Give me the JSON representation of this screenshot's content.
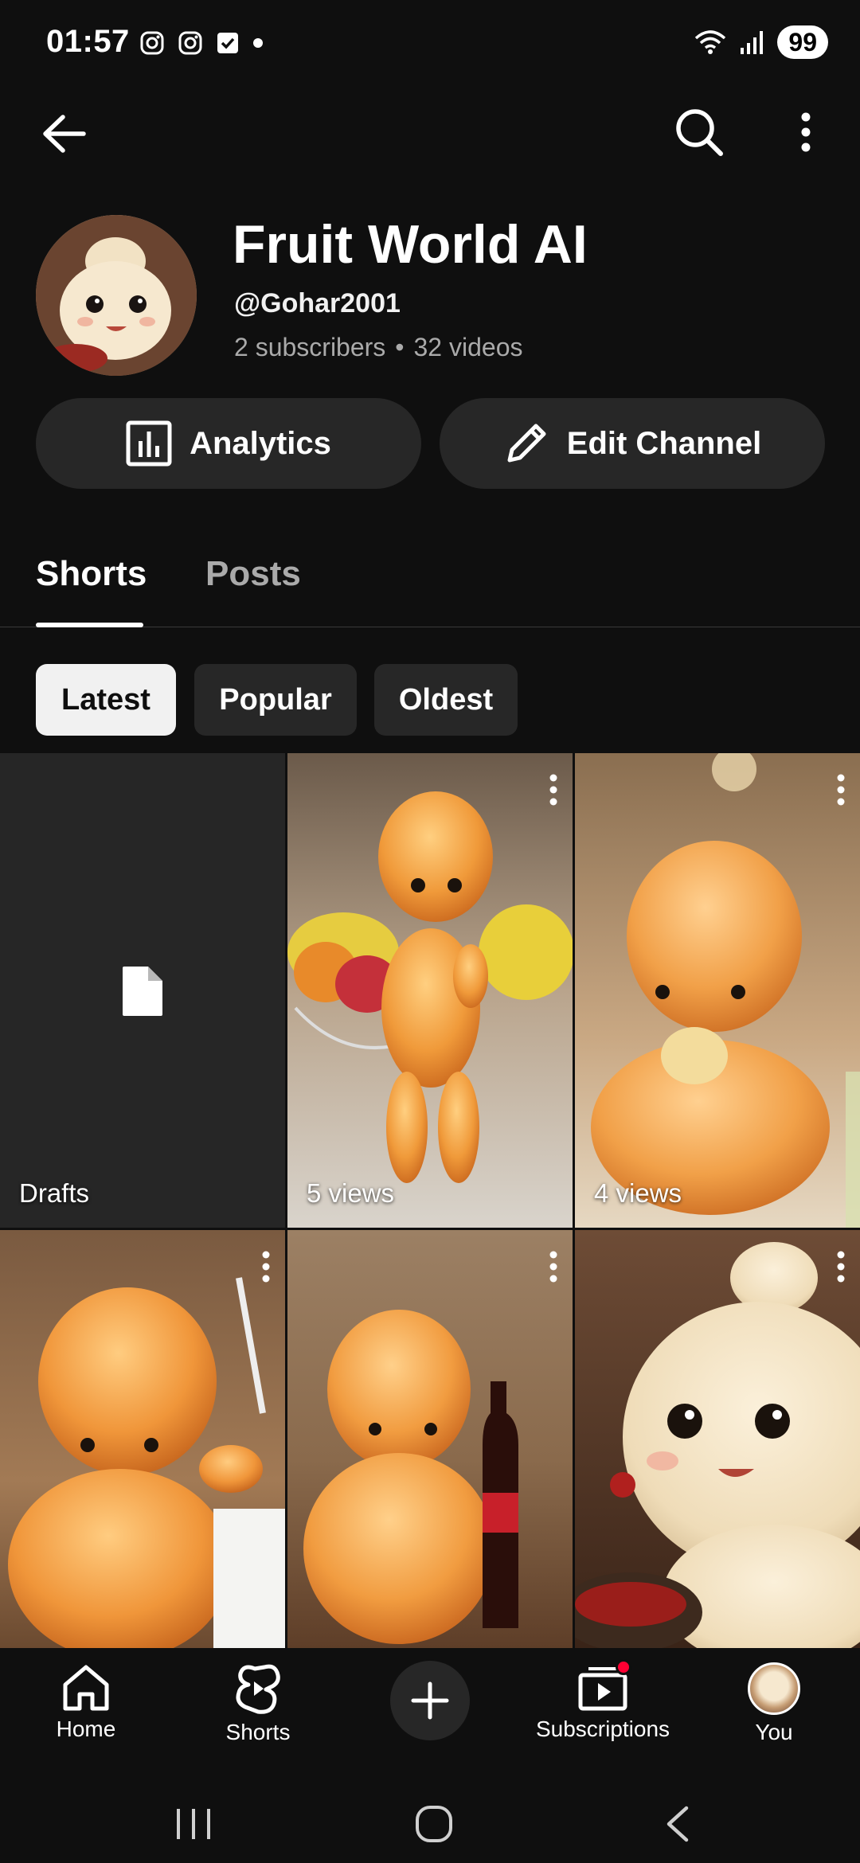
{
  "status_bar": {
    "time": "01:57",
    "battery": "99",
    "notification_icons": [
      "instagram-icon",
      "instagram-icon",
      "checkbox-icon",
      "dot-icon"
    ]
  },
  "top_bar": {
    "back_icon": "arrow-back-icon",
    "search_icon": "search-icon",
    "more_icon": "more-vert-icon"
  },
  "channel": {
    "name": "Fruit World AI",
    "handle": "@Gohar2001",
    "subscribers": "2 subscribers",
    "separator": "•",
    "videos": "32 videos"
  },
  "actions": {
    "analytics_label": "Analytics",
    "edit_label": "Edit Channel"
  },
  "tabs": [
    {
      "label": "Shorts",
      "active": true
    },
    {
      "label": "Posts",
      "active": false
    }
  ],
  "filters": [
    {
      "label": "Latest",
      "selected": true
    },
    {
      "label": "Popular",
      "selected": false
    },
    {
      "label": "Oldest",
      "selected": false
    }
  ],
  "shorts": [
    {
      "label": "Drafts",
      "type": "drafts"
    },
    {
      "label": "5 views",
      "type": "video"
    },
    {
      "label": "4 views",
      "type": "video"
    },
    {
      "label": "",
      "type": "video"
    },
    {
      "label": "",
      "type": "video"
    },
    {
      "label": "",
      "type": "video"
    }
  ],
  "bottom_nav": [
    {
      "label": "Home",
      "icon": "home-icon"
    },
    {
      "label": "Shorts",
      "icon": "shorts-icon"
    },
    {
      "label": "",
      "icon": "create-plus-icon"
    },
    {
      "label": "Subscriptions",
      "icon": "subscriptions-icon"
    },
    {
      "label": "You",
      "icon": "avatar"
    }
  ],
  "colors": {
    "background": "#0f0f0f",
    "surface": "#272727",
    "secondary_text": "#aaaaaa",
    "notification_dot": "#ff0033"
  }
}
